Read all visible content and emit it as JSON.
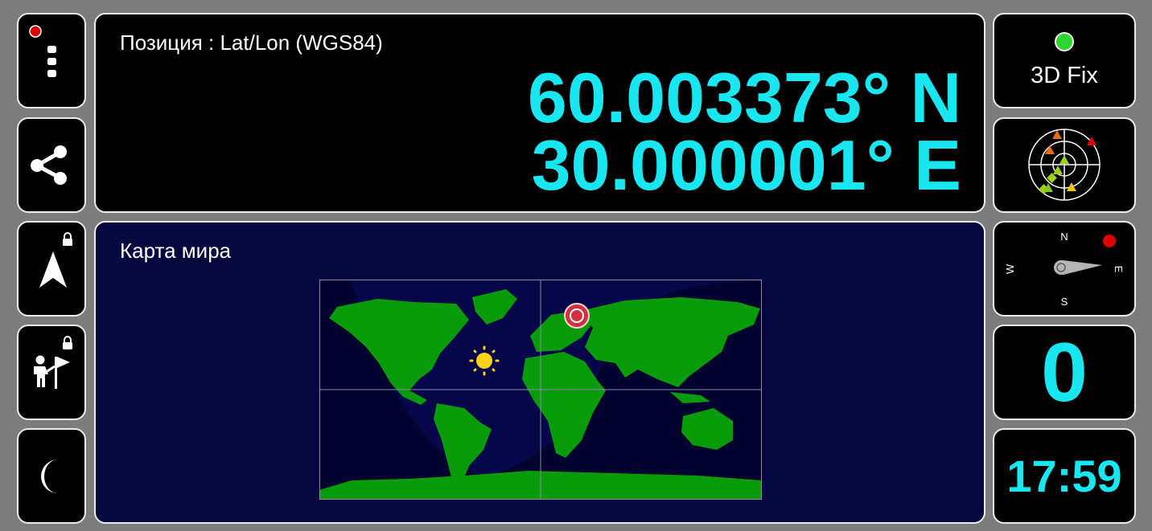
{
  "menu": {
    "status_dot_color": "#e00000",
    "icon": "vertical-dots-icon"
  },
  "share": {
    "icon": "share-icon"
  },
  "navigation": {
    "icon": "navigation-arrow-icon",
    "locked": true
  },
  "follow": {
    "icon": "person-flag-icon",
    "locked": true
  },
  "night_mode": {
    "icon": "moon-icon"
  },
  "position": {
    "title": "Позиция : Lat/Lon (WGS84)",
    "latitude": "60.003373° N",
    "longitude": "30.000001° E"
  },
  "map": {
    "title": "Карта мира",
    "land_color": "#0a9b0a",
    "ocean_color": "#06064a",
    "icons": [
      "sun-icon",
      "location-marker-icon"
    ]
  },
  "gps_fix": {
    "label": "3D Fix",
    "indicator_color": "#2fd52f"
  },
  "satellites": {
    "icon": "sky-plot-icon",
    "markers": [
      {
        "shape": "triangle",
        "color": "#e86a1a"
      },
      {
        "shape": "triangle",
        "color": "#e86a1a"
      },
      {
        "shape": "triangle",
        "color": "#e00000"
      },
      {
        "shape": "triangle",
        "color": "#9ad21a"
      },
      {
        "shape": "triangle",
        "color": "#9ad21a"
      },
      {
        "shape": "triangle",
        "color": "#f2c21a"
      },
      {
        "shape": "diamond",
        "color": "#9ad21a"
      },
      {
        "shape": "diamond",
        "color": "#9ad21a"
      },
      {
        "shape": "triangle",
        "color": "#7fcc1a"
      }
    ]
  },
  "compass": {
    "labels": {
      "north": "N",
      "south": "S",
      "east": "E",
      "west": "W"
    },
    "status_dot_color": "#e00000"
  },
  "speed": {
    "value": "0"
  },
  "clock": {
    "time": "17:59"
  },
  "accent_color": "#18e6f1"
}
